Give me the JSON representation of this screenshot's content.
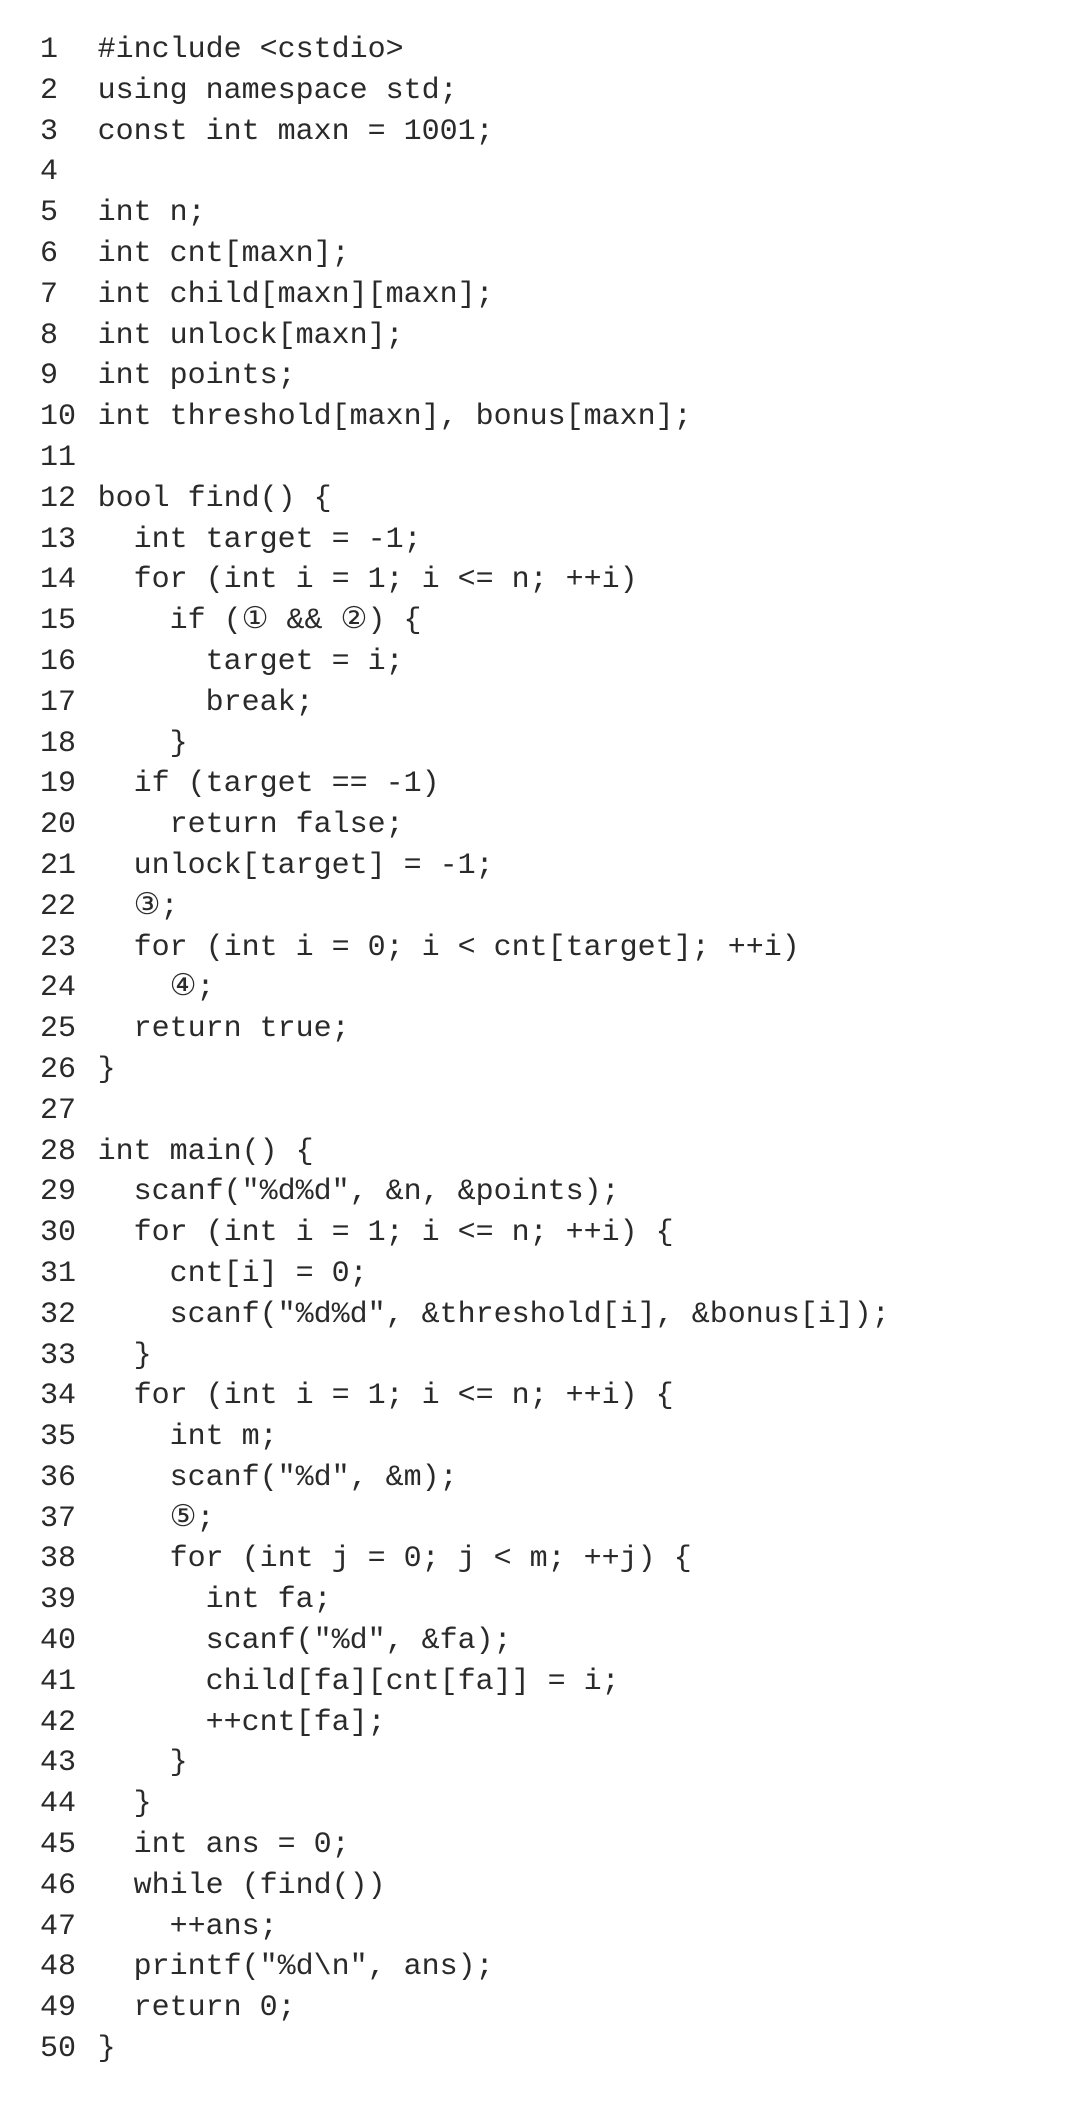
{
  "blanks": {
    "b1": "①",
    "b2": "②",
    "b3": "③",
    "b4": "④",
    "b5": "⑤"
  },
  "code_lines": [
    {
      "n": "1",
      "text": "#include <cstdio>"
    },
    {
      "n": "2",
      "text": "using namespace std;"
    },
    {
      "n": "3",
      "text": "const int maxn = 1001;"
    },
    {
      "n": "4",
      "text": ""
    },
    {
      "n": "5",
      "text": "int n;"
    },
    {
      "n": "6",
      "text": "int cnt[maxn];"
    },
    {
      "n": "7",
      "text": "int child[maxn][maxn];"
    },
    {
      "n": "8",
      "text": "int unlock[maxn];"
    },
    {
      "n": "9",
      "text": "int points;"
    },
    {
      "n": "10",
      "text": "int threshold[maxn], bonus[maxn];"
    },
    {
      "n": "11",
      "text": ""
    },
    {
      "n": "12",
      "text": "bool find() {"
    },
    {
      "n": "13",
      "text": "  int target = -1;"
    },
    {
      "n": "14",
      "text": "  for (int i = 1; i <= n; ++i)"
    },
    {
      "n": "15",
      "segments": [
        {
          "t": "    if ("
        },
        {
          "blank": "b1"
        },
        {
          "t": " && "
        },
        {
          "blank": "b2"
        },
        {
          "t": ") {"
        }
      ]
    },
    {
      "n": "16",
      "text": "      target = i;"
    },
    {
      "n": "17",
      "text": "      break;"
    },
    {
      "n": "18",
      "text": "    }"
    },
    {
      "n": "19",
      "text": "  if (target == -1)"
    },
    {
      "n": "20",
      "text": "    return false;"
    },
    {
      "n": "21",
      "text": "  unlock[target] = -1;"
    },
    {
      "n": "22",
      "segments": [
        {
          "t": "  "
        },
        {
          "blank": "b3"
        },
        {
          "t": ";"
        }
      ]
    },
    {
      "n": "23",
      "text": "  for (int i = 0; i < cnt[target]; ++i)"
    },
    {
      "n": "24",
      "segments": [
        {
          "t": "    "
        },
        {
          "blank": "b4"
        },
        {
          "t": ";"
        }
      ]
    },
    {
      "n": "25",
      "text": "  return true;"
    },
    {
      "n": "26",
      "text": "}"
    },
    {
      "n": "27",
      "text": ""
    },
    {
      "n": "28",
      "text": "int main() {"
    },
    {
      "n": "29",
      "text": "  scanf(\"%d%d\", &n, &points);"
    },
    {
      "n": "30",
      "text": "  for (int i = 1; i <= n; ++i) {"
    },
    {
      "n": "31",
      "text": "    cnt[i] = 0;"
    },
    {
      "n": "32",
      "text": "    scanf(\"%d%d\", &threshold[i], &bonus[i]);"
    },
    {
      "n": "33",
      "text": "  }"
    },
    {
      "n": "34",
      "text": "  for (int i = 1; i <= n; ++i) {"
    },
    {
      "n": "35",
      "text": "    int m;"
    },
    {
      "n": "36",
      "text": "    scanf(\"%d\", &m);"
    },
    {
      "n": "37",
      "segments": [
        {
          "t": "    "
        },
        {
          "blank": "b5"
        },
        {
          "t": ";"
        }
      ]
    },
    {
      "n": "38",
      "text": "    for (int j = 0; j < m; ++j) {"
    },
    {
      "n": "39",
      "text": "      int fa;"
    },
    {
      "n": "40",
      "text": "      scanf(\"%d\", &fa);"
    },
    {
      "n": "41",
      "text": "      child[fa][cnt[fa]] = i;"
    },
    {
      "n": "42",
      "text": "      ++cnt[fa];"
    },
    {
      "n": "43",
      "text": "    }"
    },
    {
      "n": "44",
      "text": "  }"
    },
    {
      "n": "45",
      "text": "  int ans = 0;"
    },
    {
      "n": "46",
      "text": "  while (find())"
    },
    {
      "n": "47",
      "text": "    ++ans;"
    },
    {
      "n": "48",
      "text": "  printf(\"%d\\n\", ans);"
    },
    {
      "n": "49",
      "text": "  return 0;"
    },
    {
      "n": "50",
      "text": "}"
    }
  ]
}
